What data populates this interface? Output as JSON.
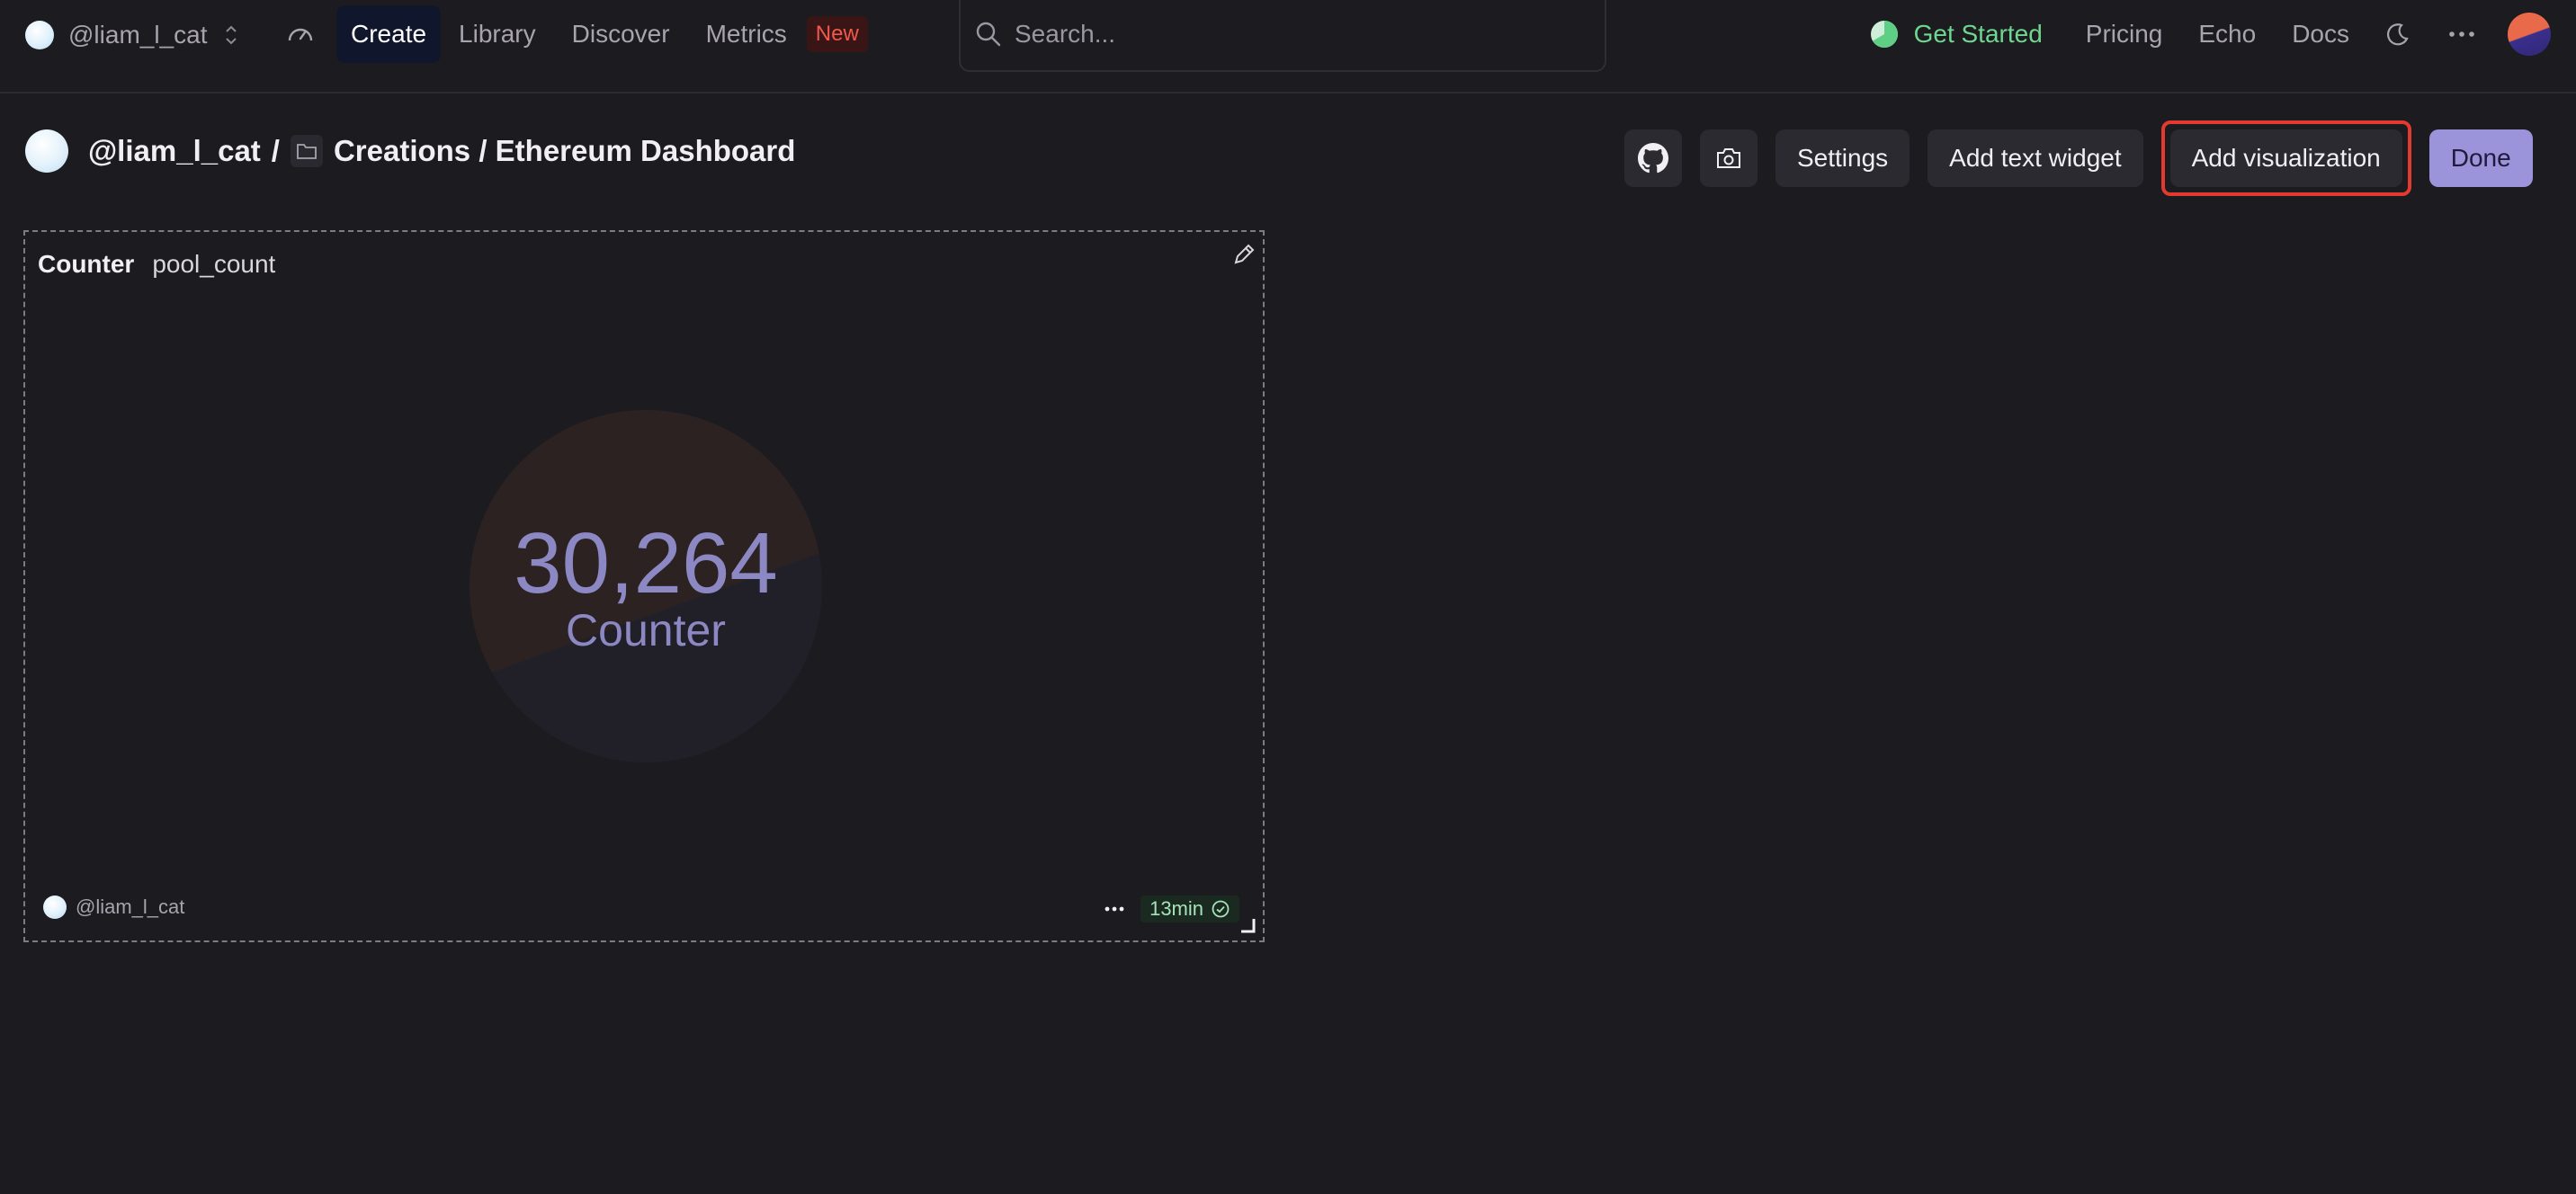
{
  "topnav": {
    "team_name": "@liam_l_cat",
    "links": [
      {
        "label": "Create",
        "active": true
      },
      {
        "label": "Library"
      },
      {
        "label": "Discover"
      },
      {
        "label": "Metrics"
      }
    ],
    "metrics_badge": "New",
    "search_placeholder": "Search...",
    "get_started": "Get Started",
    "pricing": "Pricing",
    "echo": "Echo",
    "docs": "Docs"
  },
  "breadcrumb": {
    "owner": "@liam_l_cat",
    "separator": "/",
    "path": "Creations / Ethereum Dashboard"
  },
  "toolbar": {
    "settings_label": "Settings",
    "add_text_widget_label": "Add text widget",
    "add_visualization_label": "Add visualization",
    "done_label": "Done"
  },
  "widget": {
    "type_label": "Counter",
    "query_name": "pool_count",
    "value": "30,264",
    "value_label": "Counter",
    "owner": "@liam_l_cat",
    "freshness": "13min"
  },
  "colors": {
    "background": "#1c1b1f",
    "accent": "#9c94da",
    "get_started": "#6fd68f",
    "highlight": "#e23a2e",
    "counter_text": "#8c88c4"
  }
}
